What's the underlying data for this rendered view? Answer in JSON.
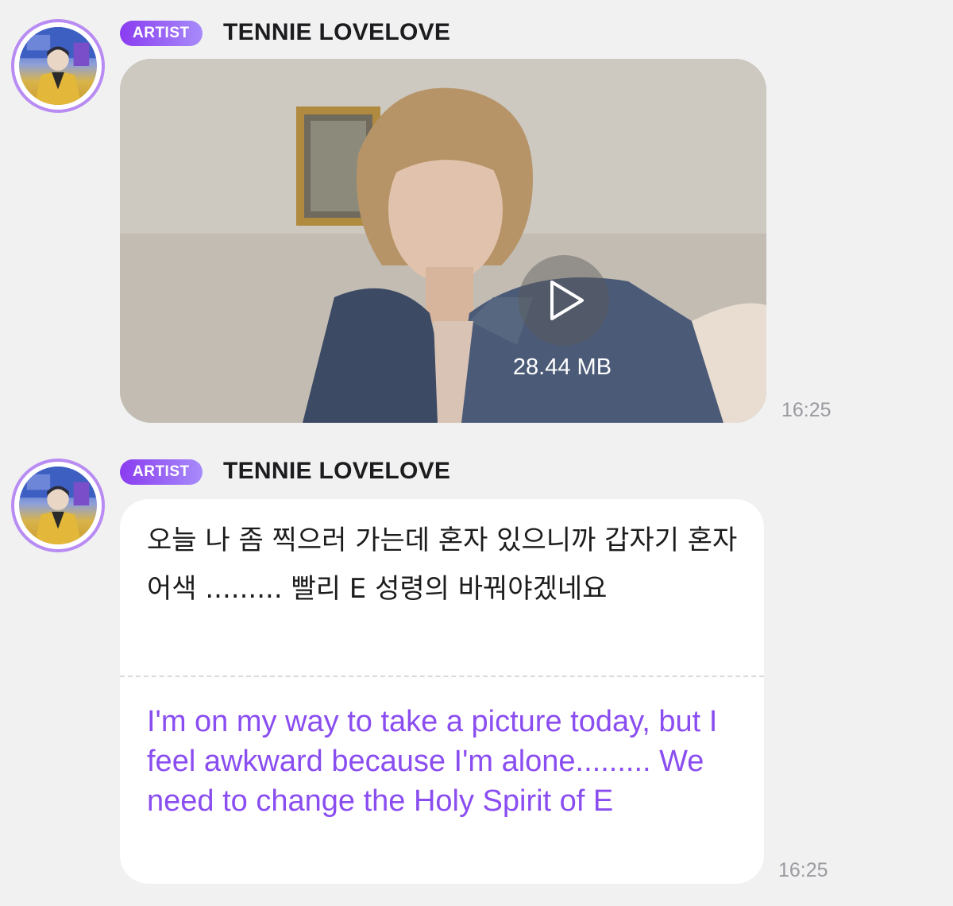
{
  "messages": [
    {
      "badge": "ARTIST",
      "sender": "TENNIE LOVELOVE",
      "type": "video",
      "file_size": "28.44 MB",
      "time": "16:25"
    },
    {
      "badge": "ARTIST",
      "sender": "TENNIE LOVELOVE",
      "type": "text",
      "original_text": "오늘 나 좀 찍으러 가는데 혼자 있으니까 갑자기 혼자 어색 ......... 빨리 E 성령의 바꿔야겠네요",
      "translated_text": "I'm on my way to take a picture today, but I feel awkward because I'm alone......... We need to change the Holy Spirit of E",
      "time": "16:25"
    }
  ],
  "colors": {
    "background": "#f1f1f2",
    "badge_gradient_start": "#8a3cf0",
    "badge_gradient_end": "#a78bfa",
    "avatar_ring": "#b88cf2",
    "translation_text": "#8a4df0",
    "timestamp": "#9a9aa0"
  },
  "icons": {
    "play": "play-icon"
  }
}
